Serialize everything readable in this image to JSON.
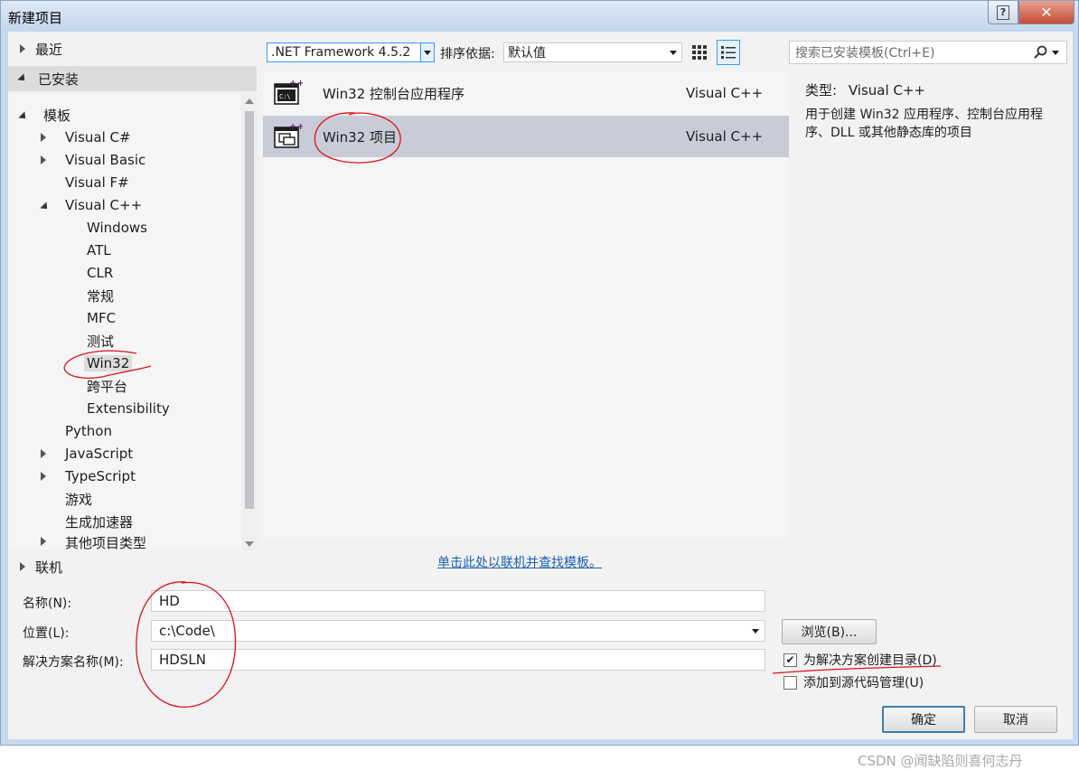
{
  "window": {
    "title": "新建项目",
    "help_label": "?",
    "close_label": "✕"
  },
  "tree": {
    "recent": "最近",
    "installed": "已安装",
    "online": "联机",
    "items": [
      {
        "label": "模板",
        "expander": "expanded"
      },
      {
        "label": "Visual C#",
        "expander": "collapsed"
      },
      {
        "label": "Visual Basic",
        "expander": "collapsed"
      },
      {
        "label": "Visual F#",
        "expander": "none"
      },
      {
        "label": "Visual C++",
        "expander": "expanded"
      },
      {
        "label": "Windows",
        "expander": "none"
      },
      {
        "label": "ATL",
        "expander": "none"
      },
      {
        "label": "CLR",
        "expander": "none"
      },
      {
        "label": "常规",
        "expander": "none"
      },
      {
        "label": "MFC",
        "expander": "none"
      },
      {
        "label": "测试",
        "expander": "none"
      },
      {
        "label": "Win32",
        "expander": "none",
        "selected": true
      },
      {
        "label": "跨平台",
        "expander": "none"
      },
      {
        "label": "Extensibility",
        "expander": "none"
      },
      {
        "label": "Python",
        "expander": "none"
      },
      {
        "label": "JavaScript",
        "expander": "collapsed"
      },
      {
        "label": "TypeScript",
        "expander": "collapsed"
      },
      {
        "label": "游戏",
        "expander": "none"
      },
      {
        "label": "生成加速器",
        "expander": "none"
      },
      {
        "label": "其他项目类型",
        "expander": "collapsed"
      }
    ]
  },
  "toolbar": {
    "framework": ".NET Framework 4.5.2",
    "sort_label": "排序依据:",
    "sort_value": "默认值",
    "search_placeholder": "搜索已安装模板(Ctrl+E)"
  },
  "templates": [
    {
      "name": "Win32 控制台应用程序",
      "lang": "Visual C++",
      "icon": "console-app-icon",
      "selected": false
    },
    {
      "name": "Win32 项目",
      "lang": "Visual C++",
      "icon": "win32-project-icon",
      "selected": true
    }
  ],
  "online_link": "单击此处以联机并查找模板。",
  "description": {
    "type_label": "类型:",
    "type_value": "Visual C++",
    "text": "用于创建 Win32 应用程序、控制台应用程序、DLL 或其他静态库的项目"
  },
  "form": {
    "name_label": "名称(N):",
    "name_value": "HD",
    "location_label": "位置(L):",
    "location_value": "c:\\Code\\",
    "solution_label": "解决方案名称(M):",
    "solution_value": "HDSLN",
    "browse_label": "浏览(B)...",
    "create_dir_label": "为解决方案创建目录(D)",
    "create_dir_checked": true,
    "source_control_label": "添加到源代码管理(U)",
    "source_control_checked": false,
    "ok_label": "确定",
    "cancel_label": "取消"
  },
  "watermark": "CSDN @闻缺陷则喜何志丹",
  "colors": {
    "selection": "#c9ccd8",
    "accent": "#3399ff",
    "annotation_ink": "#d9141a"
  }
}
